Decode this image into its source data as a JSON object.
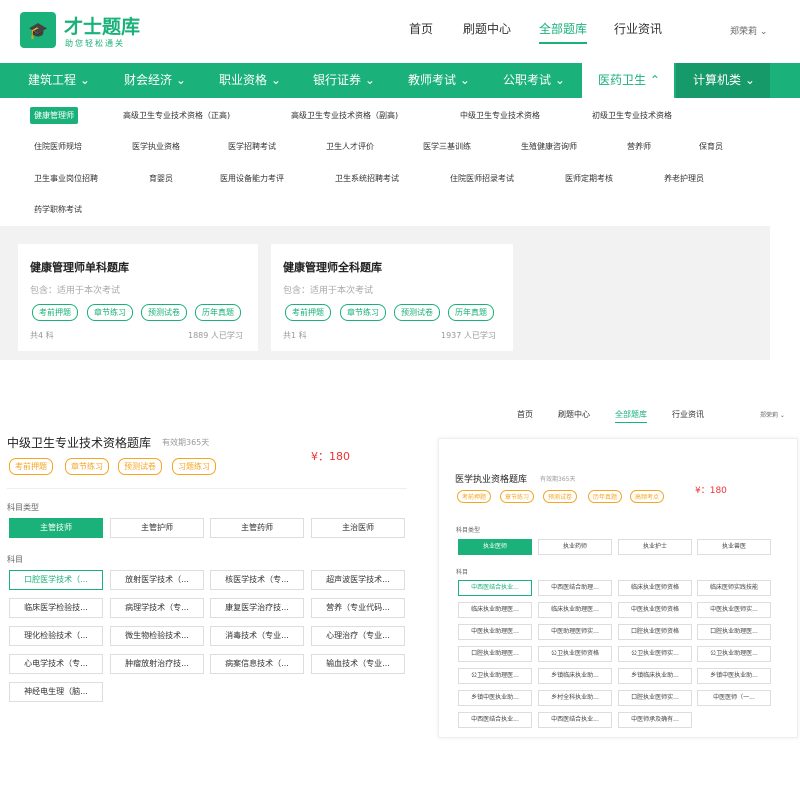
{
  "header": {
    "logo_text": "才士题库",
    "slogan": "助您轻松通关",
    "logo_badge": "才士题库",
    "nav": [
      "首页",
      "刷题中心",
      "全部题库",
      "行业资讯"
    ],
    "user": "郑荣莉"
  },
  "categories": [
    "建筑工程",
    "财会经济",
    "职业资格",
    "银行证券",
    "教师考试",
    "公职考试",
    "医药卫生",
    "计算机类"
  ],
  "submenu": [
    [
      "健康管理师",
      "高级卫生专业技术资格（正高)",
      "高级卫生专业技术资格（副高)",
      "中级卫生专业技术资格",
      "初级卫生专业技术资格"
    ],
    [
      "住院医师规培",
      "医学执业资格",
      "医学招聘考试",
      "卫生人才评价",
      "医学三基训练",
      "生殖健康咨询师",
      "营养师",
      "保育员"
    ],
    [
      "卫生事业岗位招聘",
      "育婴员",
      "医用设备能力考评",
      "卫生系统招聘考试",
      "住院医师招录考试",
      "医师定期考核",
      "养老护理员"
    ],
    [
      "药学职称考试"
    ]
  ],
  "cards": [
    {
      "title": "健康管理师单科题库",
      "sub": "包含：适用于本次考试",
      "tags": [
        "考前押题",
        "章节练习",
        "预测试卷",
        "历年真题"
      ],
      "count": "共4 科",
      "learners": "1889 人已学习"
    },
    {
      "title": "健康管理师全科题库",
      "sub": "包含：适用于本次考试",
      "tags": [
        "考前押题",
        "章节练习",
        "预测试卷",
        "历年真题"
      ],
      "count": "共1 科",
      "learners": "1937 人已学习"
    }
  ],
  "left_detail": {
    "title": "中级卫生专业技术资格题库",
    "validity": "有效期365天",
    "tags": [
      "考前押题",
      "章节练习",
      "预测试卷",
      "习题练习"
    ],
    "price": "¥：180",
    "type_label": "科目类型",
    "types": [
      "主管技师",
      "主管护师",
      "主管药师",
      "主治医师"
    ],
    "subject_label": "科目",
    "subjects": [
      "口腔医学技术（...",
      "放射医学技术（...",
      "核医学技术（专...",
      "超声波医学技术...",
      "临床医学检验技...",
      "病理学技术（专...",
      "康复医学治疗技...",
      "营养（专业代码...",
      "理化检验技术（...",
      "微生物检验技术...",
      "消毒技术（专业...",
      "心理治疗（专业...",
      "心电学技术（专...",
      "肿瘤放射治疗技...",
      "病案信息技术（...",
      "输血技术（专业...",
      "神经电生理（脑..."
    ]
  },
  "mini_nav": {
    "nav": [
      "首页",
      "刷题中心",
      "全部题库",
      "行业资讯"
    ],
    "user": "郑荣莉"
  },
  "right_detail": {
    "title": "医学执业资格题库",
    "validity": "有效期365天",
    "tags": [
      "考前押题",
      "章节练习",
      "预测试卷",
      "历年真题",
      "高频考点"
    ],
    "price": "¥：180",
    "type_label": "科目类型",
    "types": [
      "执业医师",
      "执业药师",
      "执业护士",
      "执业兽医"
    ],
    "subject_label": "科目",
    "subjects": [
      "中西医结合执业...",
      "中西医结合助理...",
      "临床执业医师资格",
      "临床医师实践技能",
      "临床执业助理医...",
      "临床执业助理医...",
      "中医执业医师资格",
      "中医执业医师实...",
      "中医执业助理医...",
      "中医助理医师实...",
      "口腔执业医师资格",
      "口腔执业助理医...",
      "口腔执业助理医...",
      "公卫执业医师资格",
      "公卫执业医师实...",
      "公卫执业助理医...",
      "公卫执业助理医...",
      "乡镇临床执业助...",
      "乡镇临床执业助...",
      "乡镇中医执业助...",
      "乡镇中医执业助...",
      "乡村全科执业助...",
      "口腔执业医师实...",
      "中医医师（一...",
      "中西医结合执业...",
      "中西医结合执业...",
      "中医师承及确有..."
    ]
  }
}
